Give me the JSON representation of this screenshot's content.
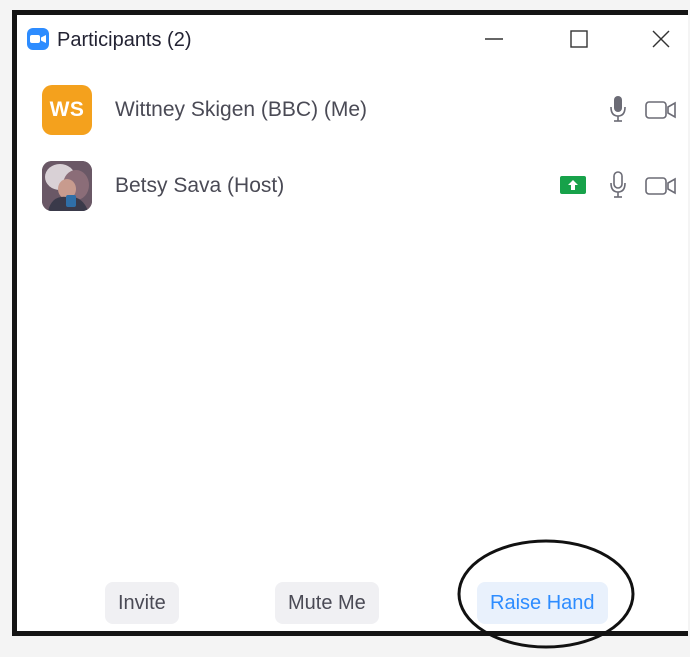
{
  "window": {
    "title": "Participants (2)",
    "controls": [
      "minimize-icon",
      "maximize-icon",
      "close-icon"
    ]
  },
  "participants": [
    {
      "name": "Wittney Skigen (BBC) (Me)",
      "initials": "WS",
      "avatar_color": "#f4a11d",
      "raised_hand": false,
      "icons": [
        "microphone-icon",
        "video-camera-icon"
      ]
    },
    {
      "name": "Betsy Sava (Host)",
      "avatar": "photo",
      "raised_hand": true,
      "hand_badge_color": "#17a24a",
      "icons": [
        "raised-hand-icon",
        "microphone-icon",
        "video-camera-icon"
      ]
    }
  ],
  "footer": {
    "invite_label": "Invite",
    "mute_label": "Mute Me",
    "raise_hand_label": "Raise Hand"
  },
  "colors": {
    "accent": "#2d8cff",
    "text": "#4a4a55",
    "button_bg": "#f0f0f3",
    "annotation": "#111111"
  }
}
